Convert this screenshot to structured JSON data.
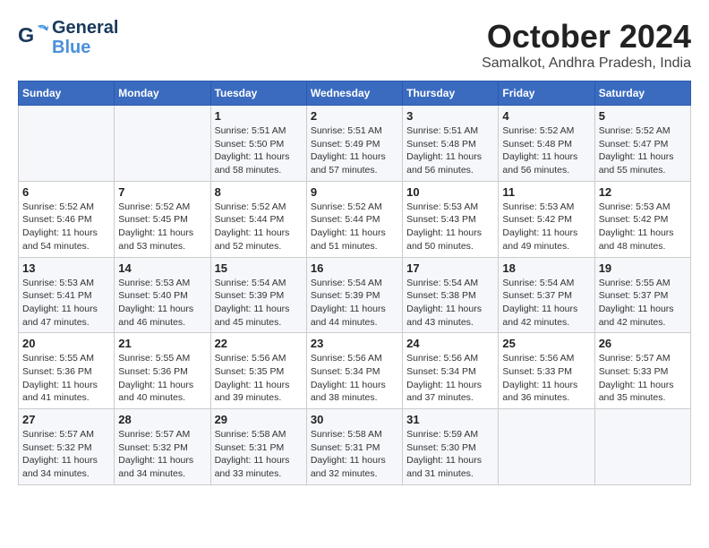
{
  "header": {
    "logo_general": "General",
    "logo_blue": "Blue",
    "month": "October 2024",
    "location": "Samalkot, Andhra Pradesh, India"
  },
  "days_of_week": [
    "Sunday",
    "Monday",
    "Tuesday",
    "Wednesday",
    "Thursday",
    "Friday",
    "Saturday"
  ],
  "weeks": [
    [
      {
        "day": "",
        "info": ""
      },
      {
        "day": "",
        "info": ""
      },
      {
        "day": "1",
        "info": "Sunrise: 5:51 AM\nSunset: 5:50 PM\nDaylight: 11 hours and 58 minutes."
      },
      {
        "day": "2",
        "info": "Sunrise: 5:51 AM\nSunset: 5:49 PM\nDaylight: 11 hours and 57 minutes."
      },
      {
        "day": "3",
        "info": "Sunrise: 5:51 AM\nSunset: 5:48 PM\nDaylight: 11 hours and 56 minutes."
      },
      {
        "day": "4",
        "info": "Sunrise: 5:52 AM\nSunset: 5:48 PM\nDaylight: 11 hours and 56 minutes."
      },
      {
        "day": "5",
        "info": "Sunrise: 5:52 AM\nSunset: 5:47 PM\nDaylight: 11 hours and 55 minutes."
      }
    ],
    [
      {
        "day": "6",
        "info": "Sunrise: 5:52 AM\nSunset: 5:46 PM\nDaylight: 11 hours and 54 minutes."
      },
      {
        "day": "7",
        "info": "Sunrise: 5:52 AM\nSunset: 5:45 PM\nDaylight: 11 hours and 53 minutes."
      },
      {
        "day": "8",
        "info": "Sunrise: 5:52 AM\nSunset: 5:44 PM\nDaylight: 11 hours and 52 minutes."
      },
      {
        "day": "9",
        "info": "Sunrise: 5:52 AM\nSunset: 5:44 PM\nDaylight: 11 hours and 51 minutes."
      },
      {
        "day": "10",
        "info": "Sunrise: 5:53 AM\nSunset: 5:43 PM\nDaylight: 11 hours and 50 minutes."
      },
      {
        "day": "11",
        "info": "Sunrise: 5:53 AM\nSunset: 5:42 PM\nDaylight: 11 hours and 49 minutes."
      },
      {
        "day": "12",
        "info": "Sunrise: 5:53 AM\nSunset: 5:42 PM\nDaylight: 11 hours and 48 minutes."
      }
    ],
    [
      {
        "day": "13",
        "info": "Sunrise: 5:53 AM\nSunset: 5:41 PM\nDaylight: 11 hours and 47 minutes."
      },
      {
        "day": "14",
        "info": "Sunrise: 5:53 AM\nSunset: 5:40 PM\nDaylight: 11 hours and 46 minutes."
      },
      {
        "day": "15",
        "info": "Sunrise: 5:54 AM\nSunset: 5:39 PM\nDaylight: 11 hours and 45 minutes."
      },
      {
        "day": "16",
        "info": "Sunrise: 5:54 AM\nSunset: 5:39 PM\nDaylight: 11 hours and 44 minutes."
      },
      {
        "day": "17",
        "info": "Sunrise: 5:54 AM\nSunset: 5:38 PM\nDaylight: 11 hours and 43 minutes."
      },
      {
        "day": "18",
        "info": "Sunrise: 5:54 AM\nSunset: 5:37 PM\nDaylight: 11 hours and 42 minutes."
      },
      {
        "day": "19",
        "info": "Sunrise: 5:55 AM\nSunset: 5:37 PM\nDaylight: 11 hours and 42 minutes."
      }
    ],
    [
      {
        "day": "20",
        "info": "Sunrise: 5:55 AM\nSunset: 5:36 PM\nDaylight: 11 hours and 41 minutes."
      },
      {
        "day": "21",
        "info": "Sunrise: 5:55 AM\nSunset: 5:36 PM\nDaylight: 11 hours and 40 minutes."
      },
      {
        "day": "22",
        "info": "Sunrise: 5:56 AM\nSunset: 5:35 PM\nDaylight: 11 hours and 39 minutes."
      },
      {
        "day": "23",
        "info": "Sunrise: 5:56 AM\nSunset: 5:34 PM\nDaylight: 11 hours and 38 minutes."
      },
      {
        "day": "24",
        "info": "Sunrise: 5:56 AM\nSunset: 5:34 PM\nDaylight: 11 hours and 37 minutes."
      },
      {
        "day": "25",
        "info": "Sunrise: 5:56 AM\nSunset: 5:33 PM\nDaylight: 11 hours and 36 minutes."
      },
      {
        "day": "26",
        "info": "Sunrise: 5:57 AM\nSunset: 5:33 PM\nDaylight: 11 hours and 35 minutes."
      }
    ],
    [
      {
        "day": "27",
        "info": "Sunrise: 5:57 AM\nSunset: 5:32 PM\nDaylight: 11 hours and 34 minutes."
      },
      {
        "day": "28",
        "info": "Sunrise: 5:57 AM\nSunset: 5:32 PM\nDaylight: 11 hours and 34 minutes."
      },
      {
        "day": "29",
        "info": "Sunrise: 5:58 AM\nSunset: 5:31 PM\nDaylight: 11 hours and 33 minutes."
      },
      {
        "day": "30",
        "info": "Sunrise: 5:58 AM\nSunset: 5:31 PM\nDaylight: 11 hours and 32 minutes."
      },
      {
        "day": "31",
        "info": "Sunrise: 5:59 AM\nSunset: 5:30 PM\nDaylight: 11 hours and 31 minutes."
      },
      {
        "day": "",
        "info": ""
      },
      {
        "day": "",
        "info": ""
      }
    ]
  ]
}
